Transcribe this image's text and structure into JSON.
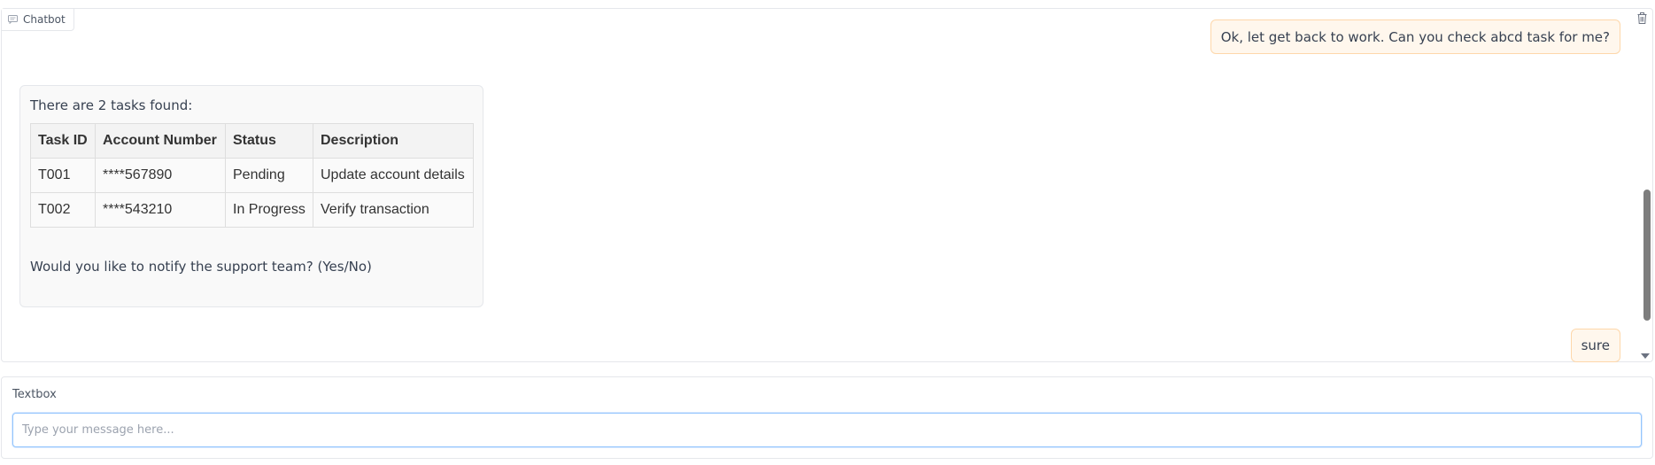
{
  "chatbot": {
    "label": "Chatbot",
    "messages": [
      {
        "role": "user",
        "text": "Ok, let get back to work. Can you check abcd task for me?"
      },
      {
        "role": "bot",
        "intro": "There are 2 tasks found:",
        "question": "Would you like to notify the support team? (Yes/No)"
      },
      {
        "role": "user",
        "text": "sure"
      }
    ]
  },
  "tasks_table": {
    "headers": [
      "Task ID",
      "Account Number",
      "Status",
      "Description"
    ],
    "rows": [
      [
        "T001",
        "****567890",
        "Pending",
        "Update account details"
      ],
      [
        "T002",
        "****543210",
        "In Progress",
        "Verify transaction"
      ]
    ]
  },
  "textbox": {
    "label": "Textbox",
    "placeholder": "Type your message here..."
  },
  "colors": {
    "user_bubble_bg": "#fff7ed",
    "user_bubble_border": "#fed7aa",
    "bot_bubble_bg": "#f9f9f9",
    "input_focus_border": "#93c5fd"
  },
  "icons": {
    "chatbot_label_icon": "chat-icon",
    "clear_button_icon": "trash-icon"
  }
}
